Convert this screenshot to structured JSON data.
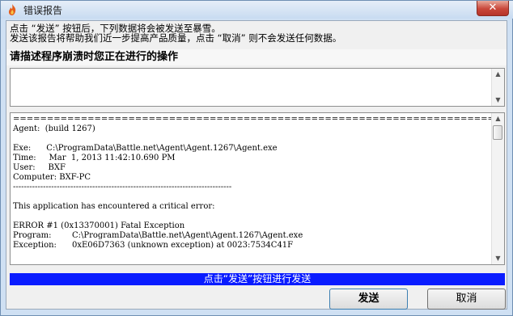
{
  "window": {
    "title": "错误报告",
    "close_label": "✕"
  },
  "intro": {
    "line1": "点击 “发送” 按钮后，下列数据将会被发送至暴雪。",
    "line2": "发送该报告将帮助我们近一步提高产品质量，点击 “取消” 则不会发送任何数据。"
  },
  "describe": {
    "heading": "请描述程序崩溃时您正在进行的操作",
    "value": ""
  },
  "log": {
    "lines": [
      "================================================================================",
      "Agent:  (build 1267)",
      "",
      "Exe:      C:\\ProgramData\\Battle.net\\Agent\\Agent.1267\\Agent.exe",
      "Time:     Mar  1, 2013 11:42:10.690 PM",
      "User:     BXF",
      "Computer: BXF-PC",
      "--------------------------------------------------------------------------------",
      "",
      "This application has encountered a critical error:",
      "",
      "ERROR #1 (0x13370001) Fatal Exception",
      "Program:        C:\\ProgramData\\Battle.net\\Agent\\Agent.1267\\Agent.exe",
      "Exception:      0xE06D7363 (unknown exception) at 0023:7534C41F"
    ]
  },
  "status": {
    "text": "点击“发送”按钮进行发送"
  },
  "buttons": {
    "send": "发送",
    "cancel": "取消"
  },
  "icons": {
    "app": "flame-icon",
    "close": "close-icon",
    "scroll_up": "scroll-up-arrow-icon",
    "scroll_down": "scroll-down-arrow-icon"
  },
  "colors": {
    "status_bar": "#0a1cff",
    "close_button": "#c9473a"
  }
}
